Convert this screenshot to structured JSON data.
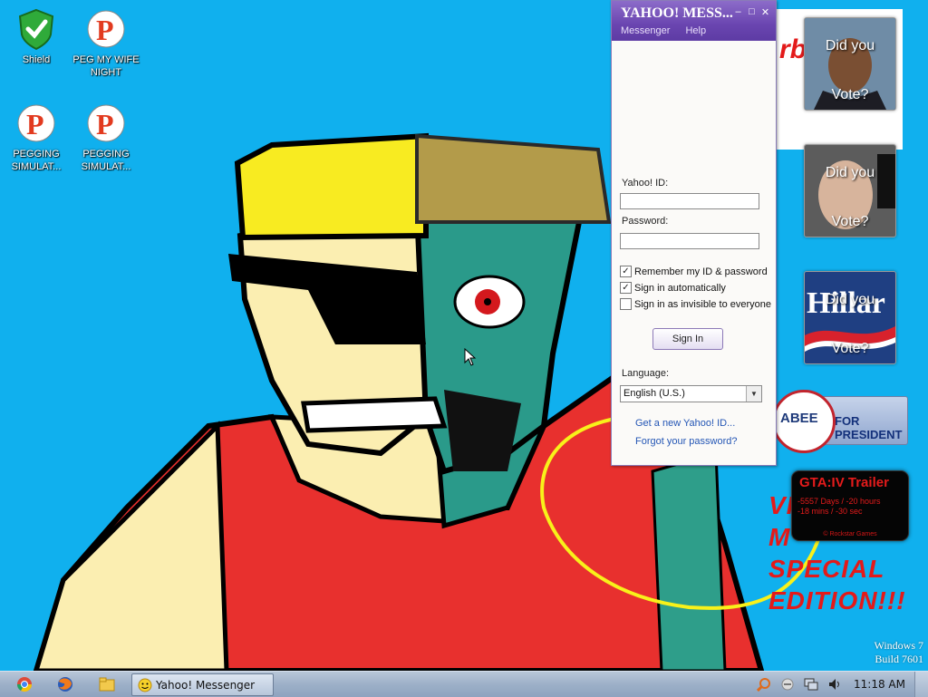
{
  "desktop": {
    "icons": [
      {
        "label": "Shield"
      },
      {
        "label": "PEG MY WIFE NIGHT"
      },
      {
        "label": "PEGGING SIMULAT..."
      },
      {
        "label": "PEGGING SIMULAT..."
      }
    ]
  },
  "gadgets": {
    "polls": [
      {
        "question": "Did you",
        "answer": "Vote?"
      },
      {
        "question": "Did you",
        "answer": "Vote?"
      },
      {
        "question": "Did you",
        "answer": "Vote?"
      }
    ],
    "banner_fragment": "rbi",
    "hillary_text": "Hillar",
    "huckabee": {
      "pin_text": "ABEE",
      "slogan": "FOR PRESIDENT"
    },
    "gta": {
      "title": "GTA:IV Trailer",
      "countdown_line1": "-5557 Days / -20 hours",
      "countdown_line2": "-18 mins / -30 sec",
      "credit": "© Rockstar Games"
    },
    "special_text": [
      "VI",
      "M",
      "SPECIAL",
      "EDITION!!!"
    ]
  },
  "yahoo_window": {
    "title": "YAHOO! MESS...",
    "menu": [
      "Messenger",
      "Help"
    ],
    "yahoo_id_label": "Yahoo! ID:",
    "yahoo_id_value": "",
    "password_label": "Password:",
    "password_value": "",
    "checkboxes": [
      {
        "label": "Remember my ID & password",
        "checked": true
      },
      {
        "label": "Sign in automatically",
        "checked": true
      },
      {
        "label": "Sign in as invisible to everyone",
        "checked": false
      }
    ],
    "signin_button": "Sign In",
    "language_label": "Language:",
    "language_value": "English (U.S.)",
    "link_new_id": "Get a new Yahoo! ID...",
    "link_forgot": "Forgot your password?"
  },
  "watermark": {
    "line1": "Windows 7",
    "line2": "Build 7601"
  },
  "taskbar": {
    "pinned": [
      "chrome-icon",
      "firefox-icon",
      "folder-icon"
    ],
    "active_window": "Yahoo! Messenger",
    "clock": "11:18 AM"
  },
  "colors": {
    "desktop_bg": "#10b0ee",
    "yahoo_purple": "#6a45b0",
    "link_blue": "#2456b5",
    "gta_red": "#e51b1b"
  }
}
